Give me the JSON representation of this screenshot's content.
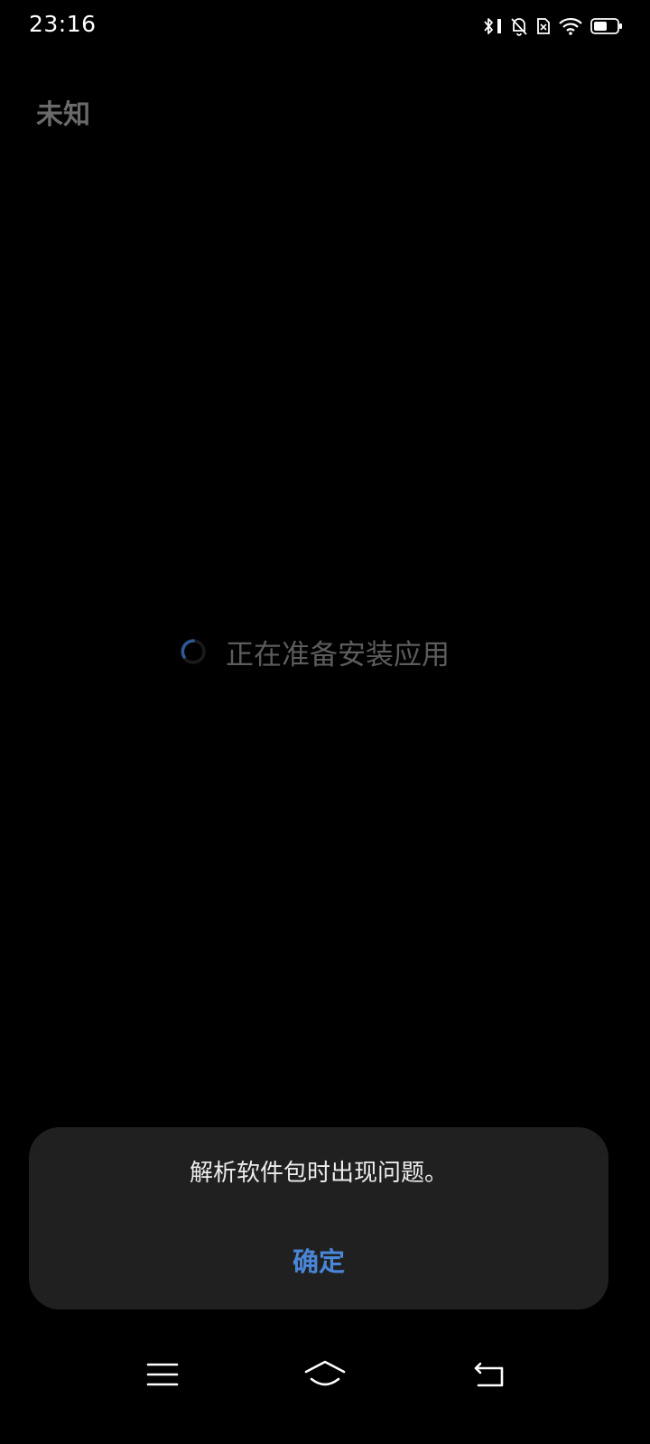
{
  "status_bar": {
    "time": "23:16",
    "icons": [
      "bluetooth-icon",
      "vibrate-icon",
      "mute-icon",
      "no-sim-icon",
      "wifi-icon",
      "battery-icon"
    ]
  },
  "app": {
    "title": "未知"
  },
  "loading": {
    "text": "正在准备安装应用"
  },
  "dialog": {
    "message": "解析软件包时出现问题。",
    "confirm_label": "确定"
  },
  "nav_bar": {
    "buttons": [
      "menu-icon",
      "home-icon",
      "back-icon"
    ]
  },
  "colors": {
    "background": "#000000",
    "dialog_bg": "#202020",
    "accent": "#4a86d8",
    "muted_text": "#5c5c5c"
  }
}
